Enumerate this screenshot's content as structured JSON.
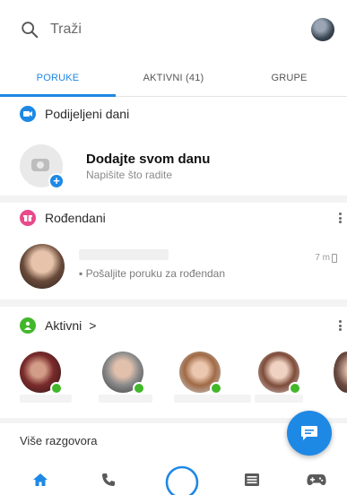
{
  "search": {
    "placeholder": "Traži",
    "icon": "search-icon"
  },
  "profile": {
    "icon": "profile-avatar"
  },
  "tabs": [
    {
      "label": "PORUKE",
      "active": true
    },
    {
      "label": "AKTIVNI (41)",
      "active": false
    },
    {
      "label": "GRUPE",
      "active": false
    }
  ],
  "stories": {
    "title": "Podijeljeni dani",
    "icon": "camera-icon",
    "icon_color": "#1e88e5",
    "add_title": "Dodajte svom danu",
    "add_subtitle": "Napišite što radite"
  },
  "birthdays": {
    "title": "Rođendani",
    "icon": "gift-icon",
    "icon_color": "#e84a8a",
    "item": {
      "message": "▪ Pošaljite poruku za rođendan",
      "time": "7 m"
    }
  },
  "active": {
    "title": "Aktivni",
    "chevron": ">",
    "icon": "person-icon",
    "icon_color": "#42b72a",
    "online_color": "#42b72a"
  },
  "more": {
    "label": "Više razgovora"
  },
  "fab": {
    "icon": "chat-bubble-icon",
    "color": "#1e88e5"
  },
  "bottom_nav": [
    {
      "icon": "home-icon",
      "active": true
    },
    {
      "icon": "phone-icon",
      "active": false
    },
    {
      "icon": "camera-circle-icon",
      "active": false
    },
    {
      "icon": "list-icon",
      "active": false
    },
    {
      "icon": "gamepad-icon",
      "active": false
    }
  ],
  "colors": {
    "accent": "#1e88e5",
    "divider": "#f3f3f3"
  }
}
